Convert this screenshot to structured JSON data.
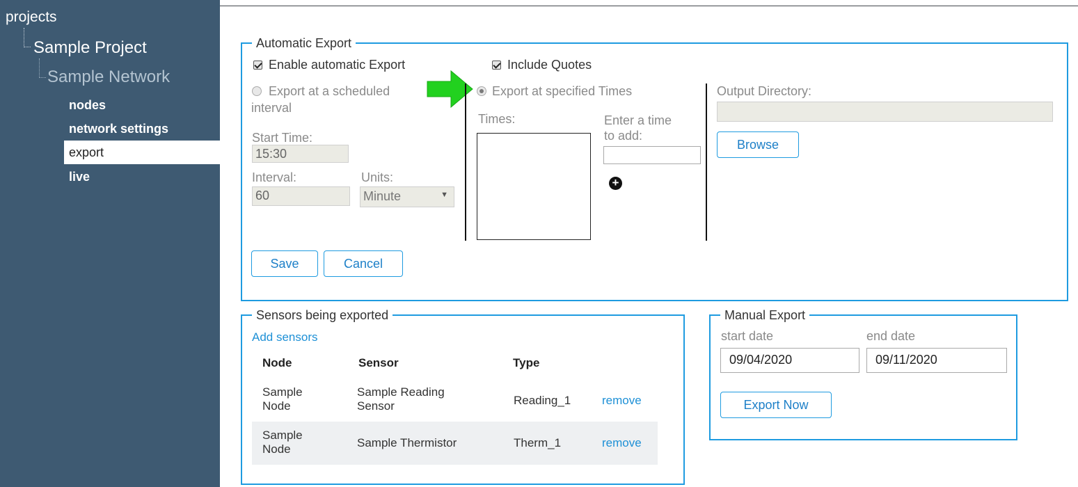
{
  "sidebar": {
    "root": "projects",
    "project": "Sample Project",
    "network": "Sample Network",
    "items": [
      {
        "label": "nodes",
        "active": false
      },
      {
        "label": "network settings",
        "active": false
      },
      {
        "label": "export",
        "active": true
      },
      {
        "label": "live",
        "active": false
      }
    ]
  },
  "auto_export": {
    "legend": "Automatic Export",
    "enable_label": "Enable automatic Export",
    "include_quotes_label": "Include Quotes",
    "scheduled_label_1": "Export at a scheduled",
    "scheduled_label_2": "interval",
    "specified_label": "Export at specified Times",
    "start_time_label": "Start Time:",
    "start_time_value": "15:30",
    "interval_label": "Interval:",
    "interval_value": "60",
    "units_label": "Units:",
    "units_value": "Minute",
    "times_label": "Times:",
    "enter_time_label_1": "Enter a time",
    "enter_time_label_2": "to add:",
    "output_dir_label": "Output Directory:",
    "output_dir_value": "",
    "browse_label": "Browse",
    "save_label": "Save",
    "cancel_label": "Cancel"
  },
  "sensors": {
    "legend": "Sensors being exported",
    "add_link": "Add sensors",
    "columns": [
      "Node",
      "Sensor",
      "Type"
    ],
    "rows": [
      {
        "node_1": "Sample",
        "node_2": "Node",
        "sensor_1": "Sample Reading",
        "sensor_2": "Sensor",
        "type": "Reading_1",
        "action": "remove"
      },
      {
        "node_1": "Sample",
        "node_2": "Node",
        "sensor_1": "Sample Thermistor",
        "sensor_2": "",
        "type": "Therm_1",
        "action": "remove"
      }
    ]
  },
  "manual_export": {
    "legend": "Manual Export",
    "start_label": "start date",
    "start_value": "09/04/2020",
    "end_label": "end date",
    "end_value": "09/11/2020",
    "export_label": "Export Now"
  },
  "colors": {
    "sidebar_bg": "#3e5a72",
    "accent": "#1e9be0",
    "link": "#1e90d6",
    "arrow": "#22d11f"
  },
  "icons": {
    "add_time": "plus-circle-icon",
    "pointer": "green-arrow-icon"
  }
}
